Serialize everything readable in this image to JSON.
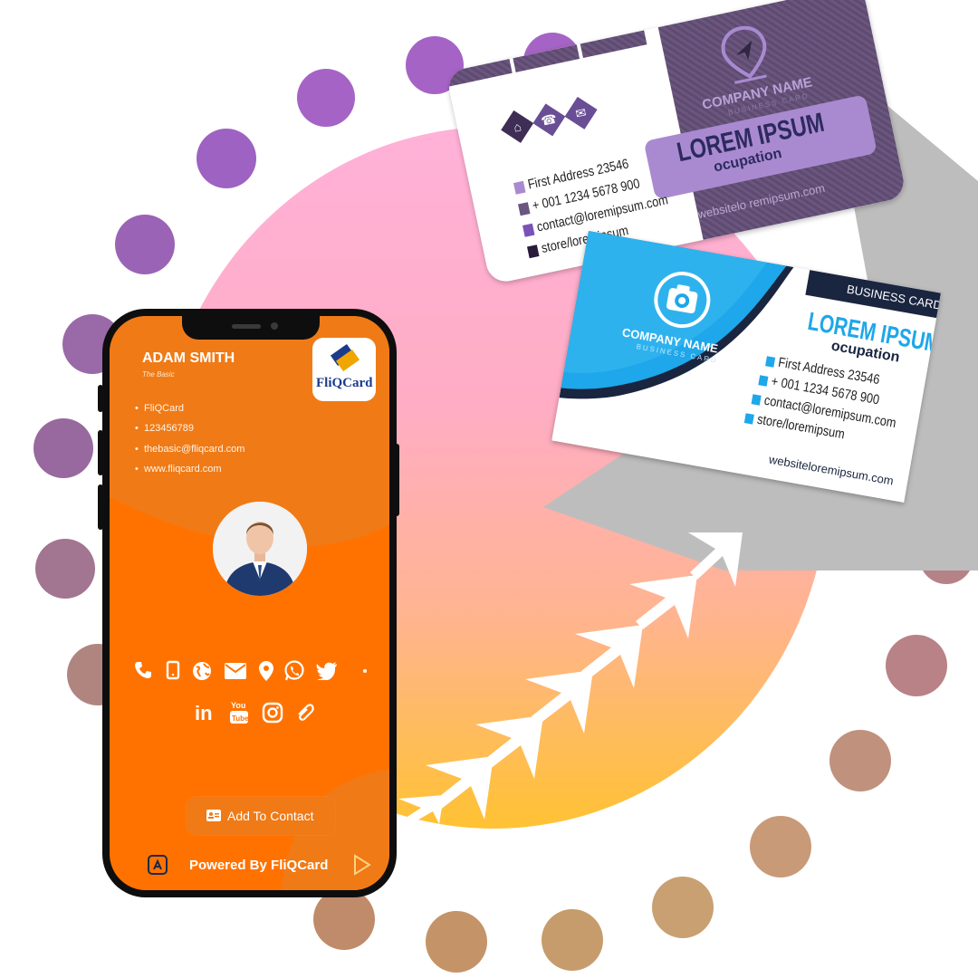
{
  "phone": {
    "name": "ADAM SMITH",
    "subtitle": "The Basic",
    "logo_text": "FliQCard",
    "details": [
      "FliQCard",
      "123456789",
      "thebasic@fliqcard.com",
      "www.fliqcard.com"
    ],
    "add_contact_label": "Add To Contact",
    "footer_text": "Powered By FliQCard",
    "accent_color": "#ff7200",
    "contact_icons": [
      "phone-icon",
      "mobile-icon",
      "globe-icon",
      "mail-icon",
      "location-icon",
      "whatsapp-icon",
      "twitter-icon"
    ],
    "social_icons": [
      "linkedin-icon",
      "youtube-icon",
      "instagram-icon",
      "link-icon"
    ]
  },
  "purple_card": {
    "company_name": "COMPANY NAME",
    "company_tagline": "BUSINESS CARD",
    "name": "LOREM IPSUM",
    "occupation": "ocupation",
    "address": "First Address 23546",
    "phone": "+ 001 1234 5678 900",
    "email": "contact@loremipsum.com",
    "web": "store/loremipsum",
    "website": "websitelo remipsum.com",
    "accent_color": "#a98ad0"
  },
  "blue_card": {
    "header": "BUSINESS CARD",
    "company_name": "COMPANY NAME",
    "company_tagline": "BUSINESS CARD",
    "name": "LOREM IPSUM",
    "occupation": "ocupation",
    "address": "First Address 23546",
    "phone": "+ 001 1234 5678 900",
    "email": "contact@loremipsum.com",
    "web": "store/loremipsum",
    "website": "websiteloremipsum.com",
    "accent_color": "#1ea7ea"
  }
}
